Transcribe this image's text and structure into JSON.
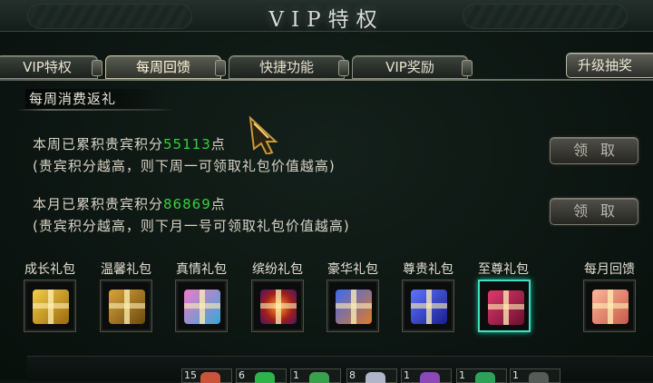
{
  "window": {
    "title": "VIP特权"
  },
  "tabs": [
    {
      "label": "VIP特权",
      "active": false
    },
    {
      "label": "每周回馈",
      "active": true
    },
    {
      "label": "快捷功能",
      "active": false
    },
    {
      "label": "VIP奖励",
      "active": false
    }
  ],
  "draw_button": {
    "label": "升级抽奖"
  },
  "section": {
    "heading": "每周消费返礼"
  },
  "weekly": {
    "prefix": "本周已累积贵宾积分",
    "points": "55113",
    "suffix": "点",
    "note": "(贵宾积分越高，则下周一可领取礼包价值越高)",
    "claim_label": "领取"
  },
  "monthly": {
    "prefix": "本月已累积贵宾积分",
    "points": "86869",
    "suffix": "点",
    "note": "(贵宾积分越高，则下月一号可领取礼包价值越高)",
    "claim_label": "领取"
  },
  "gifts": [
    {
      "label": "成长礼包",
      "icon": "gold-gift-icon",
      "color": "#d8a21c",
      "selected": false
    },
    {
      "label": "温馨礼包",
      "icon": "bronze-gift-icon",
      "color": "#b88419",
      "selected": false
    },
    {
      "label": "真情礼包",
      "icon": "pink-blue-gift-icon",
      "color": "#cf5fb4",
      "selected": false
    },
    {
      "label": "缤纷礼包",
      "icon": "purple-orange-gift-icon",
      "color": "#c2491e",
      "selected": false
    },
    {
      "label": "豪华礼包",
      "icon": "blue-orange-gift-icon",
      "color": "#3857c9",
      "selected": false
    },
    {
      "label": "尊贵礼包",
      "icon": "blue-gift-icon",
      "color": "#2a3fd0",
      "selected": false
    },
    {
      "label": "至尊礼包",
      "icon": "crimson-gift-icon",
      "color": "#b0204f",
      "selected": true
    }
  ],
  "monthly_gift": {
    "label": "每月回馈",
    "icon": "peach-gift-icon",
    "color": "#e59076"
  },
  "bottom_items": [
    {
      "count": "15",
      "color": "#c8553a"
    },
    {
      "count": "6",
      "color": "#2eb34a"
    },
    {
      "count": "1",
      "color": "#39a14d"
    },
    {
      "count": "8",
      "color": "#b0b6c8"
    },
    {
      "count": "1",
      "color": "#8b48b6"
    },
    {
      "count": "1",
      "color": "#2ea05a"
    },
    {
      "count": "1",
      "color": "#555c58"
    }
  ]
}
